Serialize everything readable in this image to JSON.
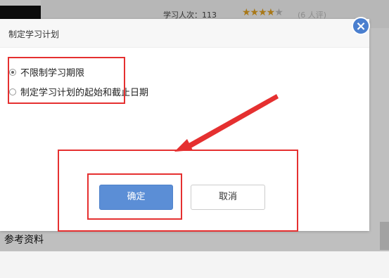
{
  "background": {
    "learners_label": "学习人次：113",
    "rating": {
      "stars_filled": 4,
      "stars_total": 5,
      "filled_glyph": "★★★★",
      "empty_glyph": "★"
    },
    "reviews_label": "(6 人评)",
    "reference_heading": "参考资料"
  },
  "dialog": {
    "title": "制定学习计划",
    "close_glyph": "×",
    "options": [
      {
        "label": "不限制学习期限",
        "checked": true
      },
      {
        "label": "制定学习计划的起始和截止日期",
        "checked": false
      }
    ],
    "confirm_label": "确定",
    "cancel_label": "取消"
  },
  "annotations": {
    "color": "#e53030"
  }
}
